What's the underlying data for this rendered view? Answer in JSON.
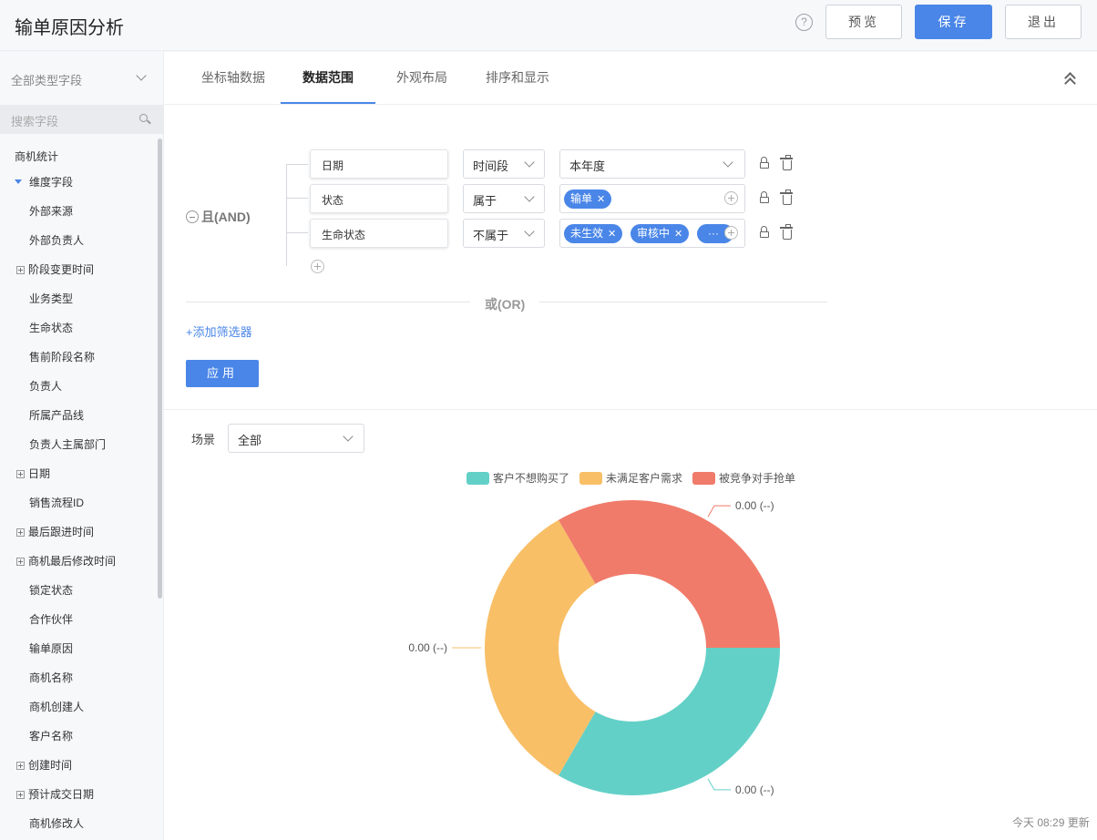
{
  "header": {
    "title": "输单原因分析",
    "help_icon": "?",
    "preview_label": "预览",
    "save_label": "保存",
    "exit_label": "退出"
  },
  "sidebar": {
    "type_select": "全部类型字段",
    "search_placeholder": "搜索字段",
    "root": "商机统计",
    "group": "维度字段",
    "items": [
      {
        "label": "外部来源",
        "expandable": false
      },
      {
        "label": "外部负责人",
        "expandable": false
      },
      {
        "label": "阶段变更时间",
        "expandable": true
      },
      {
        "label": "业务类型",
        "expandable": false
      },
      {
        "label": "生命状态",
        "expandable": false
      },
      {
        "label": "售前阶段名称",
        "expandable": false
      },
      {
        "label": "负责人",
        "expandable": false
      },
      {
        "label": "所属产品线",
        "expandable": false
      },
      {
        "label": "负责人主属部门",
        "expandable": false
      },
      {
        "label": "日期",
        "expandable": true
      },
      {
        "label": "销售流程ID",
        "expandable": false
      },
      {
        "label": "最后跟进时间",
        "expandable": true
      },
      {
        "label": "商机最后修改时间",
        "expandable": true
      },
      {
        "label": "锁定状态",
        "expandable": false
      },
      {
        "label": "合作伙伴",
        "expandable": false
      },
      {
        "label": "输单原因",
        "expandable": false
      },
      {
        "label": "商机名称",
        "expandable": false
      },
      {
        "label": "商机创建人",
        "expandable": false
      },
      {
        "label": "客户名称",
        "expandable": false
      },
      {
        "label": "创建时间",
        "expandable": true
      },
      {
        "label": "预计成交日期",
        "expandable": true
      },
      {
        "label": "商机修改人",
        "expandable": false
      }
    ]
  },
  "tabs": [
    {
      "label": "坐标轴数据",
      "active": false
    },
    {
      "label": "数据范围",
      "active": true
    },
    {
      "label": "外观布局",
      "active": false
    },
    {
      "label": "排序和显示",
      "active": false
    }
  ],
  "filters": {
    "and_label": "且(AND)",
    "rows": [
      {
        "field": "日期",
        "operator": "时间段",
        "value": "本年度",
        "tags": []
      },
      {
        "field": "状态",
        "operator": "属于",
        "value": "",
        "tags": [
          "输单"
        ]
      },
      {
        "field": "生命状态",
        "operator": "不属于",
        "value": "",
        "tags": [
          "未生效",
          "审核中",
          "···"
        ]
      }
    ],
    "or_label": "或(OR)",
    "add_filter_label": "+添加筛选器",
    "apply_label": "应用"
  },
  "scene": {
    "label": "场景",
    "value": "全部"
  },
  "chart_data": {
    "type": "pie",
    "donut": true,
    "legend_position": "top",
    "categories": [
      "客户不想购买了",
      "未满足客户需求",
      "被竞争对手抢单"
    ],
    "values": [
      0,
      0,
      0
    ],
    "colors": [
      "#63d0c7",
      "#f8bf67",
      "#f07b6a"
    ],
    "data_labels": [
      "0.00 (--)",
      "0.00 (--)",
      "0.00 (--)"
    ]
  },
  "footer": {
    "updated": "今天 08:29 更新"
  }
}
